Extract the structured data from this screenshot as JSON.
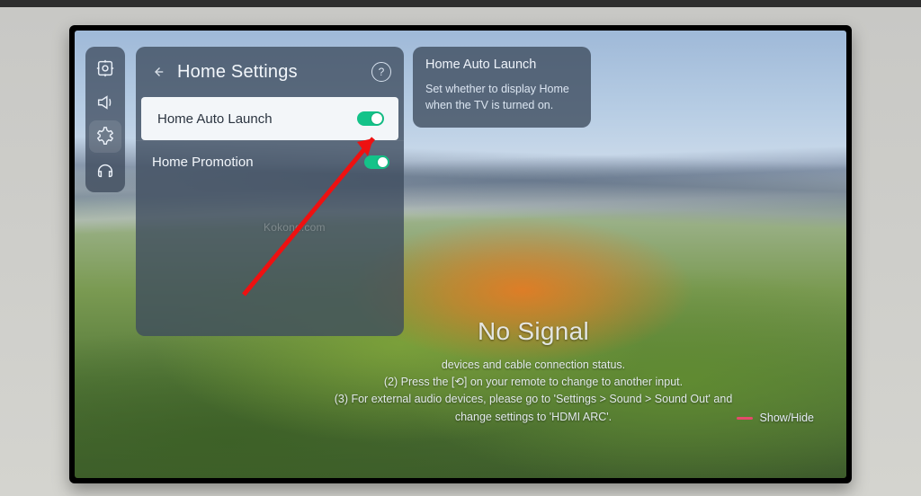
{
  "panel": {
    "title": "Home Settings",
    "help_glyph": "?",
    "items": [
      {
        "label": "Home Auto Launch",
        "on": true,
        "selected": true
      },
      {
        "label": "Home Promotion",
        "on": true,
        "selected": false
      }
    ]
  },
  "info": {
    "title": "Home Auto Launch",
    "body": "Set whether to display Home when the TV is turned on."
  },
  "rail": {
    "items": [
      "picture-icon",
      "sound-icon",
      "settings-icon",
      "support-icon"
    ],
    "active_index": 2
  },
  "no_signal": {
    "title": "No Signal",
    "lines": [
      "devices and cable connection status.",
      "(2) Press the [⟲] on your remote to change to another input.",
      "(3) For external audio devices, please go to 'Settings > Sound > Sound Out' and",
      "change settings to 'HDMI ARC'."
    ],
    "show_hide": "Show/Hide"
  },
  "watermark": "Kokond.com"
}
